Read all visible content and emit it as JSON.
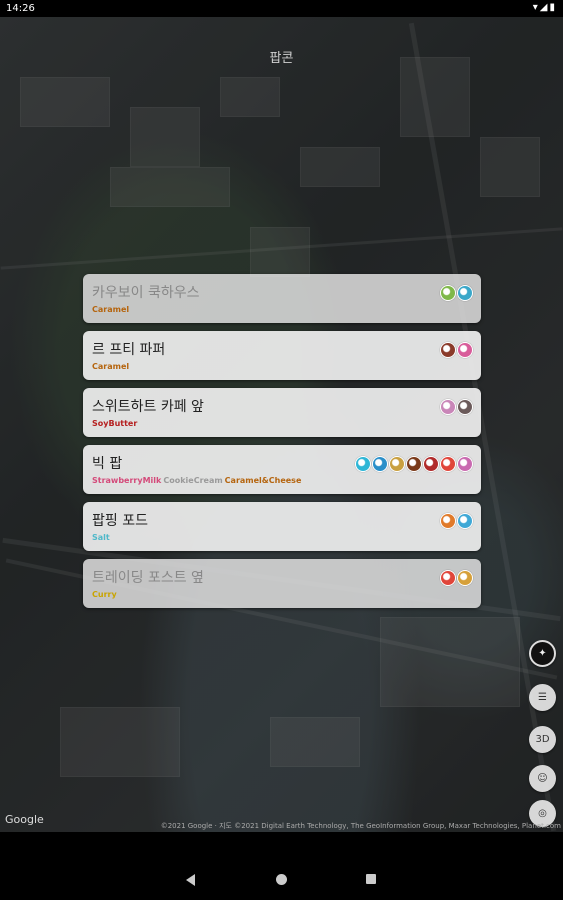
{
  "status": {
    "time": "14:26",
    "icons": "▾◢▮"
  },
  "map": {
    "title": "팝콘",
    "google_logo": "Google",
    "attribution": "©2021 Google · 지도 ©2021 Digital Earth Technology, The GeoInformation Group, Maxar Technologies, Planet.com"
  },
  "locations": [
    {
      "name": "카우보이 쿡하우스",
      "faded": true,
      "tags": [
        {
          "text": "Caramel",
          "color": "#b5650f"
        }
      ],
      "icons": [
        "#7fb84a",
        "#3aa7c9"
      ]
    },
    {
      "name": "르 프티 파퍼",
      "faded": false,
      "tags": [
        {
          "text": "Caramel",
          "color": "#b5650f"
        }
      ],
      "icons": [
        "#8a3a2a",
        "#d85c9a"
      ]
    },
    {
      "name": "스위트하트 카페 앞",
      "faded": false,
      "tags": [
        {
          "text": "SoyButter",
          "color": "#b51e1e"
        }
      ],
      "icons": [
        "#c986b8",
        "#6b5a5a"
      ]
    },
    {
      "name": "빅 팝",
      "faded": false,
      "tags": [
        {
          "text": "StrawberryMilk",
          "color": "#d44a7a"
        },
        {
          "text": "CookieCream",
          "color": "#9a9a9a"
        },
        {
          "text": "Caramel&Cheese",
          "color": "#b5650f"
        }
      ],
      "icons": [
        "#2fb6d6",
        "#2a8fc9",
        "#c9a040",
        "#7a3a1a",
        "#b02a2a",
        "#e0453a",
        "#c96ab0"
      ]
    },
    {
      "name": "팝핑 포드",
      "faded": false,
      "tags": [
        {
          "text": "Salt",
          "color": "#4fb8c9"
        }
      ],
      "icons": [
        "#e07a2a",
        "#3fa8d6"
      ]
    },
    {
      "name": "트레이딩 포스트 옆",
      "faded": true,
      "tags": [
        {
          "text": "Curry",
          "color": "#c9a400"
        }
      ],
      "icons": [
        "#e0453a",
        "#d6a03a"
      ]
    }
  ],
  "controls": {
    "compass_icon": "compass-icon",
    "list_icon": "list-icon",
    "three_d_label": "3D",
    "pegman_icon": "pegman-icon",
    "locate_icon": "locate-icon"
  }
}
